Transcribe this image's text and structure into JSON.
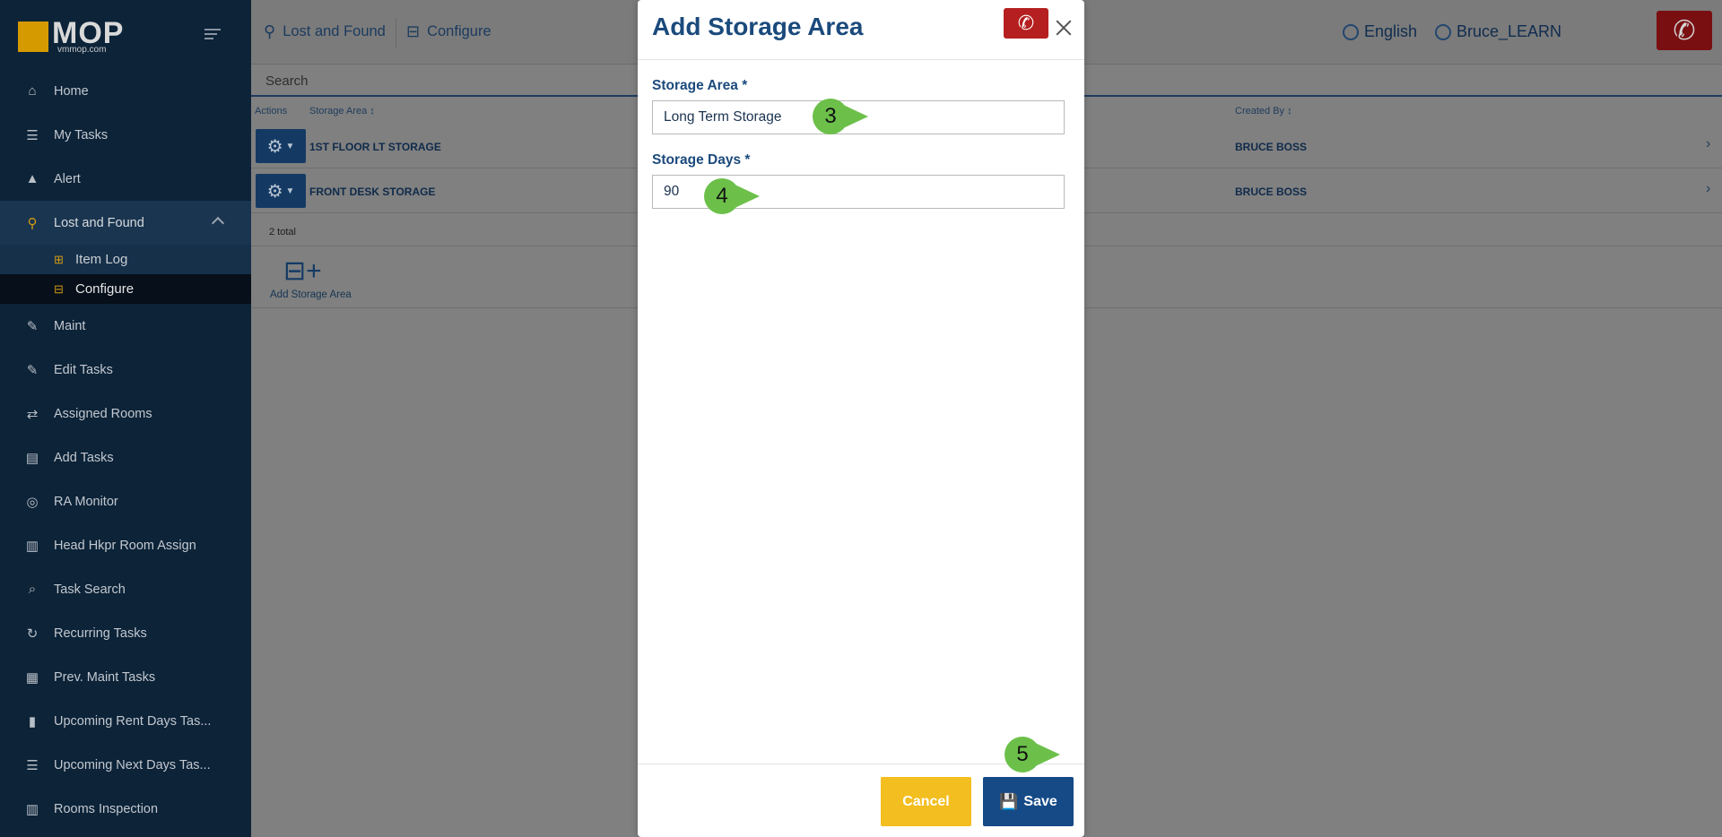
{
  "sidebar": {
    "logo": {
      "text": "MOP",
      "subtext": "vmmop.com"
    },
    "items": [
      {
        "label": "Home",
        "icon": "home-icon",
        "glyph": "⌂"
      },
      {
        "label": "My Tasks",
        "icon": "list-icon",
        "glyph": "☰"
      },
      {
        "label": "Alert",
        "icon": "warning-icon",
        "glyph": "▲"
      },
      {
        "label": "Lost and Found",
        "icon": "lost-found-icon",
        "glyph": "⚲"
      },
      {
        "label": "Maint",
        "icon": "wrench-icon",
        "glyph": "✎"
      },
      {
        "label": "Edit Tasks",
        "icon": "edit-icon",
        "glyph": "✎"
      },
      {
        "label": "Assigned Rooms",
        "icon": "swap-icon",
        "glyph": "⇄"
      },
      {
        "label": "Add Tasks",
        "icon": "table-icon",
        "glyph": "▤"
      },
      {
        "label": "RA Monitor",
        "icon": "binoculars-icon",
        "glyph": "◎"
      },
      {
        "label": "Head Hkpr Room Assign",
        "icon": "building-icon",
        "glyph": "▥"
      },
      {
        "label": "Task Search",
        "icon": "search-icon",
        "glyph": "⌕"
      },
      {
        "label": "Recurring Tasks",
        "icon": "refresh-icon",
        "glyph": "↻"
      },
      {
        "label": "Prev. Maint Tasks",
        "icon": "calendar-icon",
        "glyph": "▦"
      },
      {
        "label": "Upcoming Rent Days Tas...",
        "icon": "clipboard-icon",
        "glyph": "▮"
      },
      {
        "label": "Upcoming Next Days Tas...",
        "icon": "list-icon",
        "glyph": "☰"
      },
      {
        "label": "Rooms Inspection",
        "icon": "building-icon",
        "glyph": "▥"
      }
    ],
    "subitems": [
      {
        "label": "Item Log",
        "icon": "luggage-cart-icon",
        "glyph": "⊞"
      },
      {
        "label": "Configure",
        "icon": "warehouse-icon",
        "glyph": "⊟"
      }
    ]
  },
  "topbar": {
    "crumb1": "Lost and Found",
    "crumb2": "Configure",
    "language": "English",
    "user": "Bruce_LEARN"
  },
  "search": {
    "placeholder": "Search"
  },
  "table": {
    "col_actions": "Actions",
    "col_area": "Storage Area ↕",
    "col_created": "Created By ↕",
    "rows": [
      {
        "name": "1ST FLOOR LT STORAGE",
        "created_by": "BRUCE BOSS"
      },
      {
        "name": "FRONT DESK STORAGE",
        "created_by": "BRUCE BOSS"
      }
    ],
    "total": "2 total",
    "add_label": "Add Storage Area"
  },
  "modal": {
    "title": "Add Storage Area",
    "storage_area_label": "Storage Area *",
    "storage_area_value": "Long Term Storage",
    "storage_days_label": "Storage Days *",
    "storage_days_value": "90",
    "cancel_label": "Cancel",
    "save_label": "Save"
  },
  "markers": [
    "3",
    "4",
    "5"
  ],
  "colors": {
    "sidebar_bg": "#0c2338",
    "accent_blue": "#154a86",
    "cancel_yellow": "#f3be1f",
    "phone_red": "#b51f1f",
    "marker_green": "#6cc04a"
  }
}
